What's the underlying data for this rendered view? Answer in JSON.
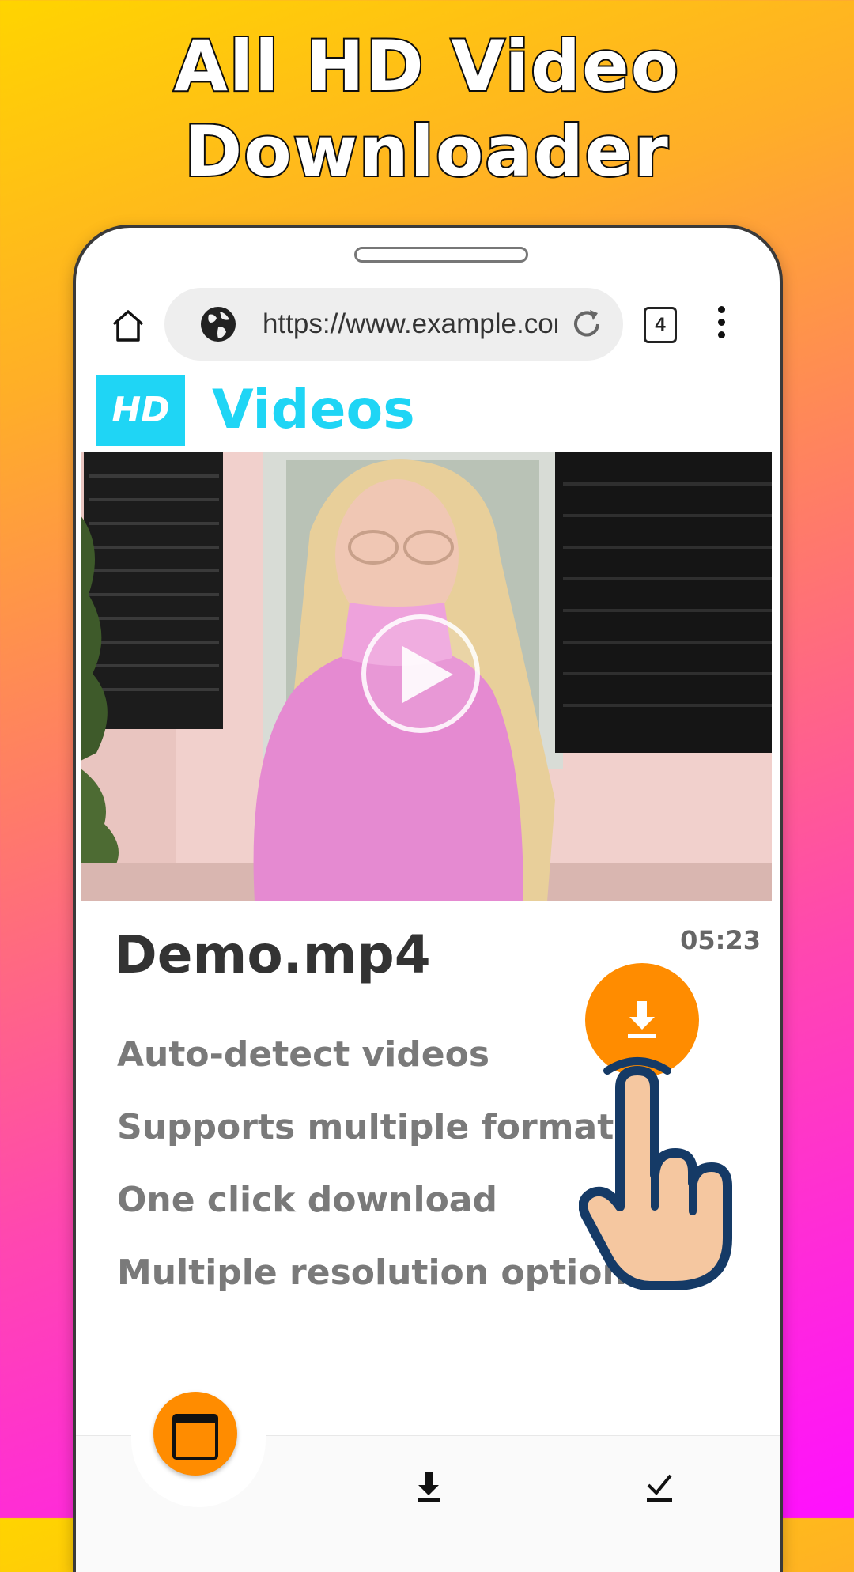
{
  "headline": {
    "line1": "All HD Video",
    "line2": "Downloader"
  },
  "browser": {
    "url": "https://www.example.com",
    "tab_count": "4",
    "icons": [
      "home-icon",
      "globe-icon",
      "reload-icon",
      "more-vert-icon"
    ]
  },
  "brand": {
    "logo_text": "HD",
    "title": "Videos",
    "accent": "#1fd5f5"
  },
  "video": {
    "file_name": "Demo.mp4",
    "duration": "05:23"
  },
  "features": [
    "Auto-detect videos",
    "Supports multiple formats",
    "One click download",
    "Multiple resolution options"
  ],
  "colors": {
    "fab": "#ff8c00",
    "gradient_top": "#ffd400",
    "gradient_bottom": "#ff10ff"
  },
  "bottom_nav": {
    "items": [
      "tabs-icon",
      "download-icon",
      "check-icon"
    ]
  }
}
